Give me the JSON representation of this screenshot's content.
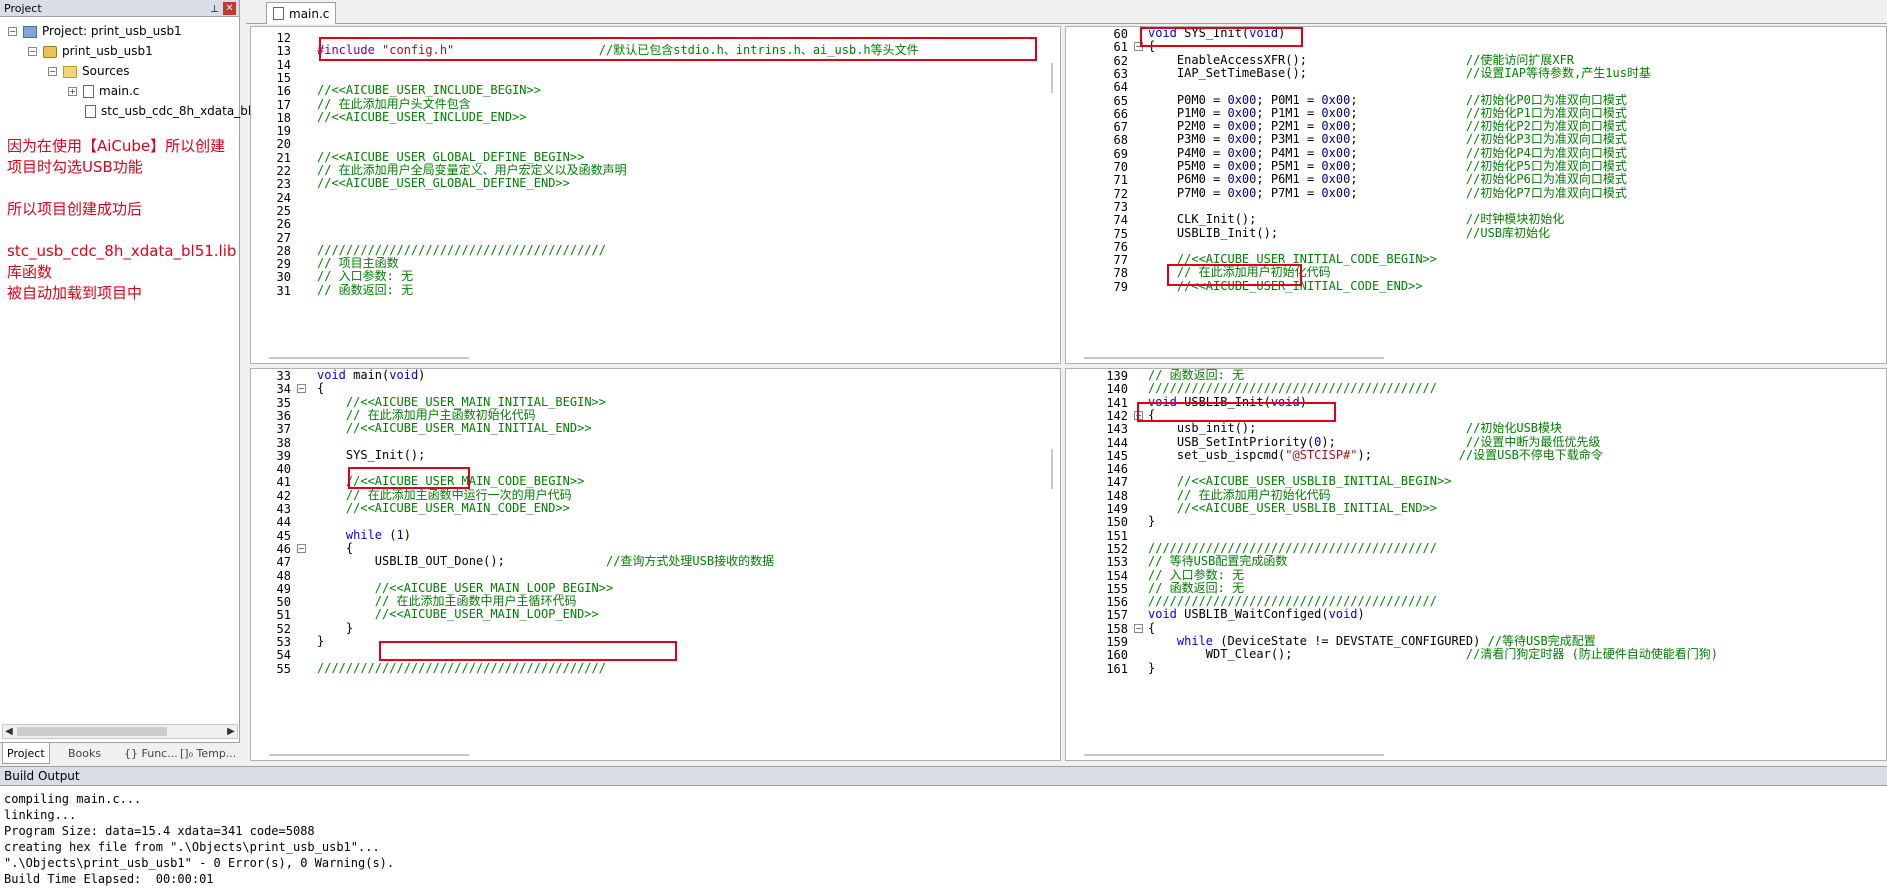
{
  "project_panel": {
    "title": "Project",
    "pin_glyph": "⊥",
    "close_glyph": "✕",
    "tree": [
      {
        "label": "Project: print_usb_usb1",
        "icon": "project-icon",
        "toggle": "−"
      },
      {
        "label": "print_usb_usb1",
        "icon": "target-icon",
        "toggle": "−"
      },
      {
        "label": "Sources",
        "icon": "folder-icon",
        "toggle": "−"
      },
      {
        "label": "main.c",
        "icon": "file-icon",
        "toggle": "+"
      },
      {
        "label": "stc_usb_cdc_8h_xdata_bl",
        "icon": "file-icon",
        "toggle": ""
      }
    ],
    "notes": [
      "因为在使用【AiCube】所以创建",
      "项目时勾选USB功能",
      "所以项目创建成功后",
      "stc_usb_cdc_8h_xdata_bl51.lib",
      "库函数",
      "被自动加载到项目中"
    ],
    "bottom_tabs": [
      "Project",
      "Books",
      "{} Func...",
      "[]₀ Temp..."
    ]
  },
  "editor": {
    "active_tab": "main.c",
    "panes": [
      {
        "lines": [
          [
            "12",
            ""
          ],
          [
            "13",
            "#include \"config.h\"                    //默认已包含stdio.h、intrins.h、ai_usb.h等头文件"
          ],
          [
            "14",
            ""
          ],
          [
            "15",
            ""
          ],
          [
            "16",
            "//<<AICUBE_USER_INCLUDE_BEGIN>>"
          ],
          [
            "17",
            "// 在此添加用户头文件包含"
          ],
          [
            "18",
            "//<<AICUBE_USER_INCLUDE_END>>"
          ],
          [
            "19",
            ""
          ],
          [
            "20",
            ""
          ],
          [
            "21",
            "//<<AICUBE_USER_GLOBAL_DEFINE_BEGIN>>"
          ],
          [
            "22",
            "// 在此添加用户全局变量定义、用户宏定义以及函数声明"
          ],
          [
            "23",
            "//<<AICUBE_USER_GLOBAL_DEFINE_END>>"
          ],
          [
            "24",
            ""
          ],
          [
            "25",
            ""
          ],
          [
            "26",
            ""
          ],
          [
            "27",
            ""
          ],
          [
            "28",
            "////////////////////////////////////////"
          ],
          [
            "29",
            "// 项目主函数"
          ],
          [
            "30",
            "// 入口参数: 无"
          ],
          [
            "31",
            "// 函数返回: 无"
          ]
        ]
      },
      {
        "lines": [
          [
            "60",
            "void SYS_Init(void)"
          ],
          [
            "61",
            "{"
          ],
          [
            "62",
            "    EnableAccessXFR();                      //使能访问扩展XFR"
          ],
          [
            "63",
            "    IAP_SetTimeBase();                      //设置IAP等待参数,产生1us时基"
          ],
          [
            "64",
            ""
          ],
          [
            "65",
            "    P0M0 = 0x00; P0M1 = 0x00;               //初始化P0口为准双向口模式"
          ],
          [
            "66",
            "    P1M0 = 0x00; P1M1 = 0x00;               //初始化P1口为准双向口模式"
          ],
          [
            "67",
            "    P2M0 = 0x00; P2M1 = 0x00;               //初始化P2口为准双向口模式"
          ],
          [
            "68",
            "    P3M0 = 0x00; P3M1 = 0x00;               //初始化P3口为准双向口模式"
          ],
          [
            "69",
            "    P4M0 = 0x00; P4M1 = 0x00;               //初始化P4口为准双向口模式"
          ],
          [
            "70",
            "    P5M0 = 0x00; P5M1 = 0x00;               //初始化P5口为准双向口模式"
          ],
          [
            "71",
            "    P6M0 = 0x00; P6M1 = 0x00;               //初始化P6口为准双向口模式"
          ],
          [
            "72",
            "    P7M0 = 0x00; P7M1 = 0x00;               //初始化P7口为准双向口模式"
          ],
          [
            "73",
            ""
          ],
          [
            "74",
            "    CLK_Init();                             //时钟模块初始化"
          ],
          [
            "75",
            "    USBLIB_Init();                          //USB库初始化"
          ],
          [
            "76",
            ""
          ],
          [
            "77",
            "    //<<AICUBE_USER_INITIAL_CODE_BEGIN>>"
          ],
          [
            "78",
            "    // 在此添加用户初始化代码"
          ],
          [
            "79",
            "    //<<AICUBE_USER_INITIAL_CODE_END>>"
          ]
        ]
      },
      {
        "lines": [
          [
            "33",
            "void main(void)"
          ],
          [
            "34",
            "{"
          ],
          [
            "35",
            "    //<<AICUBE_USER_MAIN_INITIAL_BEGIN>>"
          ],
          [
            "36",
            "    // 在此添加用户主函数初始化代码"
          ],
          [
            "37",
            "    //<<AICUBE_USER_MAIN_INITIAL_END>>"
          ],
          [
            "38",
            ""
          ],
          [
            "39",
            "    SYS_Init();"
          ],
          [
            "40",
            ""
          ],
          [
            "41",
            "    //<<AICUBE_USER_MAIN_CODE_BEGIN>>"
          ],
          [
            "42",
            "    // 在此添加主函数中运行一次的用户代码"
          ],
          [
            "43",
            "    //<<AICUBE_USER_MAIN_CODE_END>>"
          ],
          [
            "44",
            ""
          ],
          [
            "45",
            "    while (1)"
          ],
          [
            "46",
            "    {"
          ],
          [
            "47",
            "        USBLIB_OUT_Done();              //查询方式处理USB接收的数据"
          ],
          [
            "48",
            ""
          ],
          [
            "49",
            "        //<<AICUBE_USER_MAIN_LOOP_BEGIN>>"
          ],
          [
            "50",
            "        // 在此添加主函数中用户主循环代码"
          ],
          [
            "51",
            "        //<<AICUBE_USER_MAIN_LOOP_END>>"
          ],
          [
            "52",
            "    }"
          ],
          [
            "53",
            "}"
          ],
          [
            "54",
            ""
          ],
          [
            "55",
            "////////////////////////////////////////"
          ]
        ]
      },
      {
        "lines": [
          [
            "139",
            "// 函数返回: 无"
          ],
          [
            "140",
            "////////////////////////////////////////"
          ],
          [
            "141",
            "void USBLIB_Init(void)"
          ],
          [
            "142",
            "{"
          ],
          [
            "143",
            "    usb_init();                             //初始化USB模块"
          ],
          [
            "144",
            "    USB_SetIntPriority(0);                  //设置中断为最低优先级"
          ],
          [
            "145",
            "    set_usb_ispcmd(\"@STCISP#\");            //设置USB不停电下载命令"
          ],
          [
            "146",
            ""
          ],
          [
            "147",
            "    //<<AICUBE_USER_USBLIB_INITIAL_BEGIN>>"
          ],
          [
            "148",
            "    // 在此添加用户初始化代码"
          ],
          [
            "149",
            "    //<<AICUBE_USER_USBLIB_INITIAL_END>>"
          ],
          [
            "150",
            "}"
          ],
          [
            "151",
            ""
          ],
          [
            "152",
            "////////////////////////////////////////"
          ],
          [
            "153",
            "// 等待USB配置完成函数"
          ],
          [
            "154",
            "// 入口参数: 无"
          ],
          [
            "155",
            "// 函数返回: 无"
          ],
          [
            "156",
            "////////////////////////////////////////"
          ],
          [
            "157",
            "void USBLIB_WaitConfiged(void)"
          ],
          [
            "158",
            "{"
          ],
          [
            "159",
            "    while (DeviceState != DEVSTATE_CONFIGURED) //等待USB完成配置"
          ],
          [
            "160",
            "        WDT_Clear();                        //清看门狗定时器 (防止硬件自动使能看门狗)"
          ],
          [
            "161",
            "}"
          ]
        ]
      }
    ]
  },
  "build_output": {
    "title": "Build Output",
    "lines": [
      "compiling main.c...",
      "linking...",
      "Program Size: data=15.4 xdata=341 code=5088",
      "creating hex file from \".\\Objects\\print_usb_usb1\"...",
      "\".\\Objects\\print_usb_usb1\" - 0 Error(s), 0 Warning(s).",
      "Build Time Elapsed:  00:00:01"
    ]
  },
  "colors": {
    "annotation_red": "#e0001a",
    "comment_green": "#008000",
    "keyword_blue": "#0000ff",
    "string_red": "#a31515",
    "panel_header": "#d8dde7"
  }
}
